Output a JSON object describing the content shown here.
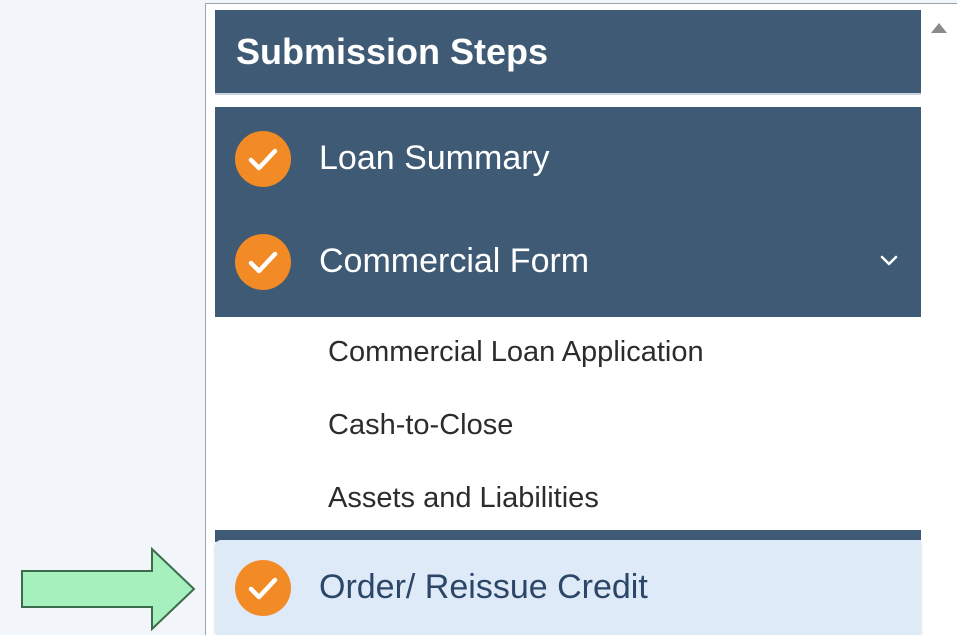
{
  "panel": {
    "title": "Submission Steps"
  },
  "steps": [
    {
      "label": "Loan Summary",
      "status": "complete",
      "icon": "check-icon"
    },
    {
      "label": "Commercial Form",
      "status": "complete",
      "icon": "check-icon",
      "expanded": true,
      "toggle_icon": "chevron-down-icon",
      "sub_items": [
        {
          "label": "Commercial Loan Application"
        },
        {
          "label": "Cash-to-Close"
        },
        {
          "label": "Assets and Liabilities"
        }
      ]
    },
    {
      "label": "Order/ Reissue Credit",
      "status": "complete",
      "icon": "check-icon",
      "active": true
    }
  ],
  "annotation": {
    "icon": "green-arrow-icon",
    "color": "#a6f0be"
  },
  "colors": {
    "header_bg": "#3f5a75",
    "check_orange": "#f28a25",
    "active_bg": "#dfeaf9",
    "active_text": "#2b4667"
  }
}
